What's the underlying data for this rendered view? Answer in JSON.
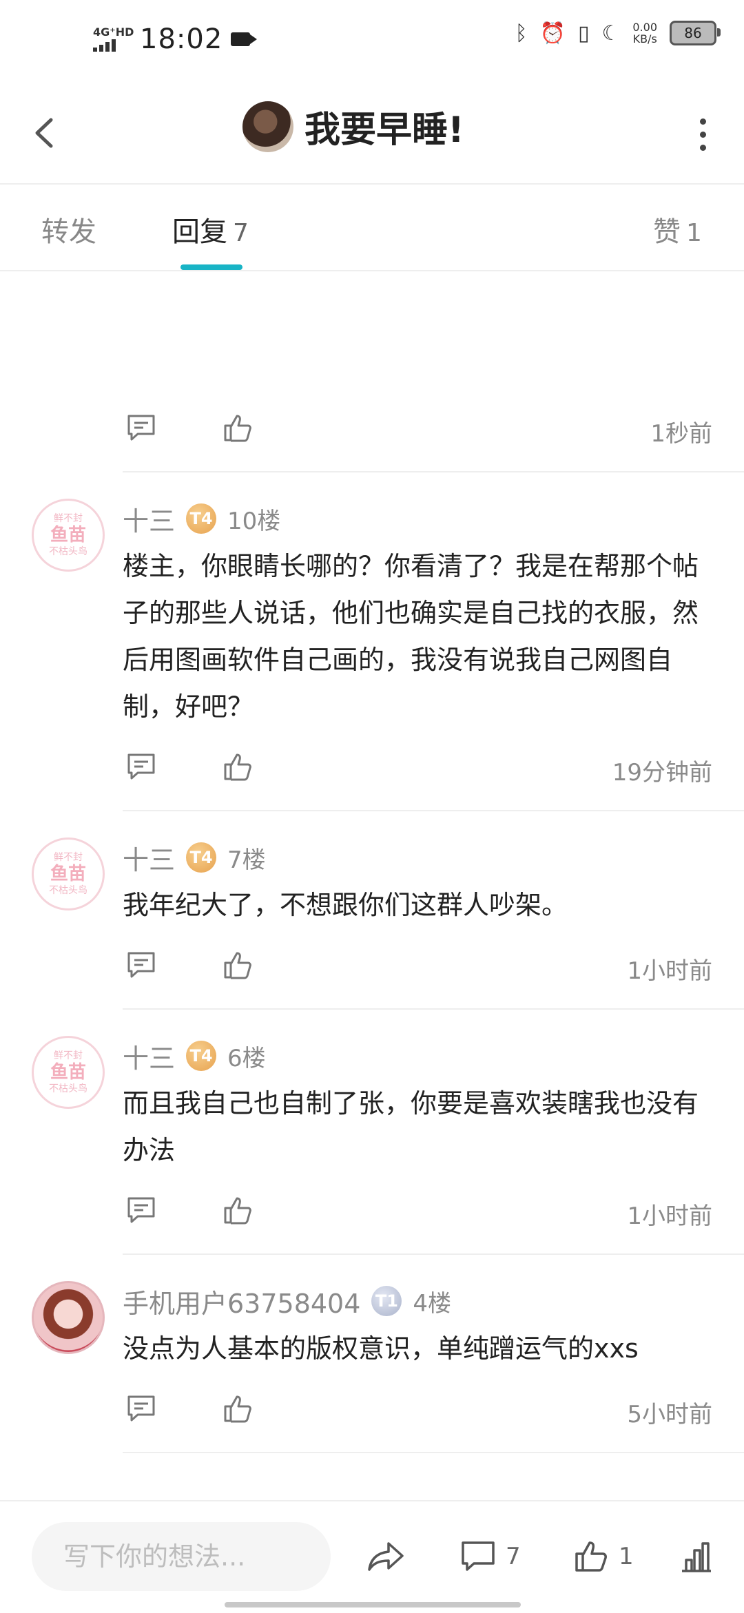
{
  "status_bar": {
    "network": "4G⁺HD",
    "time": "18:02",
    "speed_value": "0.00",
    "speed_unit": "KB/s",
    "battery": "86"
  },
  "header": {
    "title": "我要早睡!"
  },
  "tabs": [
    {
      "label": "转发",
      "count": ""
    },
    {
      "label": "回复",
      "count": "7"
    },
    {
      "label": "赞",
      "count": "1"
    }
  ],
  "colors": {
    "accent": "#18b4c6",
    "level_gold": "#e7a24e",
    "level_silver": "#aab3cb"
  },
  "replies": [
    {
      "username": "",
      "level": "",
      "floor": "",
      "content": "",
      "time": "1秒前"
    },
    {
      "username": "十三",
      "level": "T4",
      "floor": "10楼",
      "content": "楼主，你眼睛长哪的？你看清了？我是在帮那个帖子的那些人说话，他们也确实是自己找的衣服，然后用图画软件自己画的，我没有说我自己网图自制，好吧？",
      "time": "19分钟前",
      "avatar_text": [
        "鲜不封",
        "鱼苗",
        "不枯头鸟"
      ]
    },
    {
      "username": "十三",
      "level": "T4",
      "floor": "7楼",
      "content": "我年纪大了，不想跟你们这群人吵架。",
      "time": "1小时前",
      "avatar_text": [
        "鲜不封",
        "鱼苗",
        "不枯头鸟"
      ]
    },
    {
      "username": "十三",
      "level": "T4",
      "floor": "6楼",
      "content": "而且我自己也自制了张，你要是喜欢装瞎我也没有办法",
      "time": "1小时前",
      "avatar_text": [
        "鲜不封",
        "鱼苗",
        "不枯头鸟"
      ]
    },
    {
      "username": "手机用户63758404",
      "level": "T1",
      "floor": "4楼",
      "content": "没点为人基本的版权意识，单纯蹭运气的xxs",
      "time": "5小时前"
    }
  ],
  "bottom_bar": {
    "input_placeholder": "写下你的想法...",
    "comment_count": "7",
    "like_count": "1"
  }
}
